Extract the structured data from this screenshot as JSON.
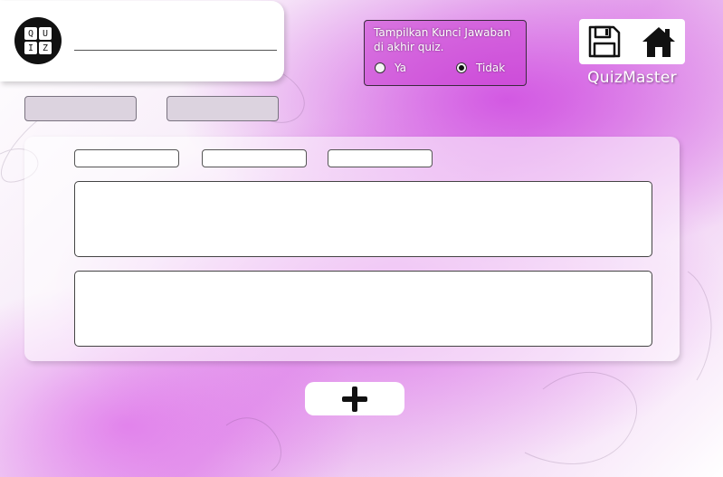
{
  "app": {
    "brand_name": "QuizMaster"
  },
  "logo": {
    "letters": [
      "Q",
      "U",
      "I",
      "Z"
    ]
  },
  "title_field": {
    "value": ""
  },
  "top_tabs": [
    {
      "label": ""
    },
    {
      "label": ""
    }
  ],
  "answer_key": {
    "question": "Tampilkan Kunci Jawaban di akhir quiz.",
    "options": [
      {
        "label": "Ya",
        "selected": false
      },
      {
        "label": "Tidak",
        "selected": true
      }
    ]
  },
  "toolbar": {
    "save_icon": "floppy-disk-icon",
    "home_icon": "house-icon"
  },
  "question_card": {
    "options_tabs": [
      {
        "label": ""
      },
      {
        "label": ""
      },
      {
        "label": ""
      }
    ],
    "question_text": "",
    "answer_text": ""
  },
  "add_button": {
    "icon": "plus-icon"
  },
  "colors": {
    "accent": "#d04fe0",
    "panel": "#ffffff",
    "text_dark": "#111111"
  }
}
